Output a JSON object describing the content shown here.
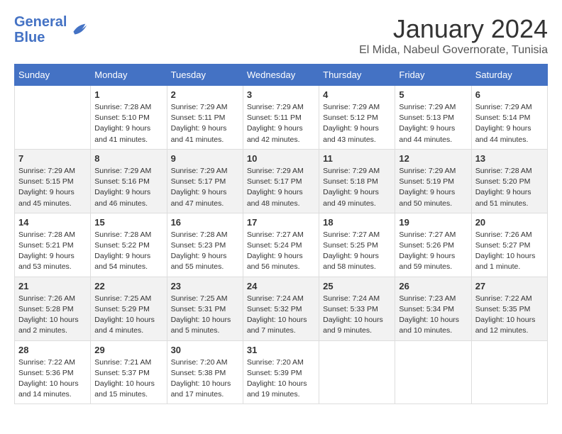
{
  "logo": {
    "line1": "General",
    "line2": "Blue"
  },
  "title": "January 2024",
  "subtitle": "El Mida, Nabeul Governorate, Tunisia",
  "weekdays": [
    "Sunday",
    "Monday",
    "Tuesday",
    "Wednesday",
    "Thursday",
    "Friday",
    "Saturday"
  ],
  "rows": [
    [
      {
        "num": "",
        "info": ""
      },
      {
        "num": "1",
        "info": "Sunrise: 7:28 AM\nSunset: 5:10 PM\nDaylight: 9 hours\nand 41 minutes."
      },
      {
        "num": "2",
        "info": "Sunrise: 7:29 AM\nSunset: 5:11 PM\nDaylight: 9 hours\nand 41 minutes."
      },
      {
        "num": "3",
        "info": "Sunrise: 7:29 AM\nSunset: 5:11 PM\nDaylight: 9 hours\nand 42 minutes."
      },
      {
        "num": "4",
        "info": "Sunrise: 7:29 AM\nSunset: 5:12 PM\nDaylight: 9 hours\nand 43 minutes."
      },
      {
        "num": "5",
        "info": "Sunrise: 7:29 AM\nSunset: 5:13 PM\nDaylight: 9 hours\nand 44 minutes."
      },
      {
        "num": "6",
        "info": "Sunrise: 7:29 AM\nSunset: 5:14 PM\nDaylight: 9 hours\nand 44 minutes."
      }
    ],
    [
      {
        "num": "7",
        "info": "Sunrise: 7:29 AM\nSunset: 5:15 PM\nDaylight: 9 hours\nand 45 minutes."
      },
      {
        "num": "8",
        "info": "Sunrise: 7:29 AM\nSunset: 5:16 PM\nDaylight: 9 hours\nand 46 minutes."
      },
      {
        "num": "9",
        "info": "Sunrise: 7:29 AM\nSunset: 5:17 PM\nDaylight: 9 hours\nand 47 minutes."
      },
      {
        "num": "10",
        "info": "Sunrise: 7:29 AM\nSunset: 5:17 PM\nDaylight: 9 hours\nand 48 minutes."
      },
      {
        "num": "11",
        "info": "Sunrise: 7:29 AM\nSunset: 5:18 PM\nDaylight: 9 hours\nand 49 minutes."
      },
      {
        "num": "12",
        "info": "Sunrise: 7:29 AM\nSunset: 5:19 PM\nDaylight: 9 hours\nand 50 minutes."
      },
      {
        "num": "13",
        "info": "Sunrise: 7:28 AM\nSunset: 5:20 PM\nDaylight: 9 hours\nand 51 minutes."
      }
    ],
    [
      {
        "num": "14",
        "info": "Sunrise: 7:28 AM\nSunset: 5:21 PM\nDaylight: 9 hours\nand 53 minutes."
      },
      {
        "num": "15",
        "info": "Sunrise: 7:28 AM\nSunset: 5:22 PM\nDaylight: 9 hours\nand 54 minutes."
      },
      {
        "num": "16",
        "info": "Sunrise: 7:28 AM\nSunset: 5:23 PM\nDaylight: 9 hours\nand 55 minutes."
      },
      {
        "num": "17",
        "info": "Sunrise: 7:27 AM\nSunset: 5:24 PM\nDaylight: 9 hours\nand 56 minutes."
      },
      {
        "num": "18",
        "info": "Sunrise: 7:27 AM\nSunset: 5:25 PM\nDaylight: 9 hours\nand 58 minutes."
      },
      {
        "num": "19",
        "info": "Sunrise: 7:27 AM\nSunset: 5:26 PM\nDaylight: 9 hours\nand 59 minutes."
      },
      {
        "num": "20",
        "info": "Sunrise: 7:26 AM\nSunset: 5:27 PM\nDaylight: 10 hours\nand 1 minute."
      }
    ],
    [
      {
        "num": "21",
        "info": "Sunrise: 7:26 AM\nSunset: 5:28 PM\nDaylight: 10 hours\nand 2 minutes."
      },
      {
        "num": "22",
        "info": "Sunrise: 7:25 AM\nSunset: 5:29 PM\nDaylight: 10 hours\nand 4 minutes."
      },
      {
        "num": "23",
        "info": "Sunrise: 7:25 AM\nSunset: 5:31 PM\nDaylight: 10 hours\nand 5 minutes."
      },
      {
        "num": "24",
        "info": "Sunrise: 7:24 AM\nSunset: 5:32 PM\nDaylight: 10 hours\nand 7 minutes."
      },
      {
        "num": "25",
        "info": "Sunrise: 7:24 AM\nSunset: 5:33 PM\nDaylight: 10 hours\nand 9 minutes."
      },
      {
        "num": "26",
        "info": "Sunrise: 7:23 AM\nSunset: 5:34 PM\nDaylight: 10 hours\nand 10 minutes."
      },
      {
        "num": "27",
        "info": "Sunrise: 7:22 AM\nSunset: 5:35 PM\nDaylight: 10 hours\nand 12 minutes."
      }
    ],
    [
      {
        "num": "28",
        "info": "Sunrise: 7:22 AM\nSunset: 5:36 PM\nDaylight: 10 hours\nand 14 minutes."
      },
      {
        "num": "29",
        "info": "Sunrise: 7:21 AM\nSunset: 5:37 PM\nDaylight: 10 hours\nand 15 minutes."
      },
      {
        "num": "30",
        "info": "Sunrise: 7:20 AM\nSunset: 5:38 PM\nDaylight: 10 hours\nand 17 minutes."
      },
      {
        "num": "31",
        "info": "Sunrise: 7:20 AM\nSunset: 5:39 PM\nDaylight: 10 hours\nand 19 minutes."
      },
      {
        "num": "",
        "info": ""
      },
      {
        "num": "",
        "info": ""
      },
      {
        "num": "",
        "info": ""
      }
    ]
  ]
}
